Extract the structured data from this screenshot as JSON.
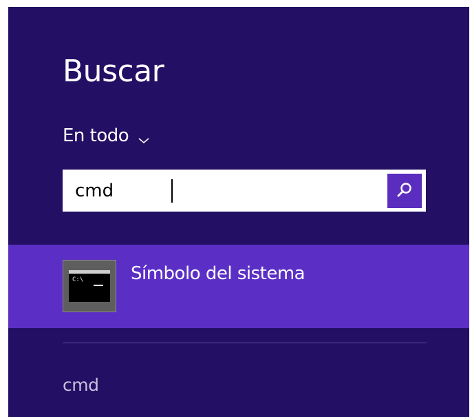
{
  "search_panel": {
    "title": "Buscar",
    "scope": {
      "label": "En todo",
      "icon": "chevron-down-icon"
    },
    "search_box": {
      "value": "cmd",
      "button_icon": "search-icon"
    },
    "results": [
      {
        "label": "Símbolo del sistema",
        "icon": "command-prompt-icon",
        "icon_text": "C:\\"
      }
    ],
    "suggestions": [
      {
        "label": "cmd"
      }
    ]
  },
  "colors": {
    "panel_background": "#230f64",
    "selected_row": "#5b2fc5",
    "search_button": "#5a2dbf"
  }
}
